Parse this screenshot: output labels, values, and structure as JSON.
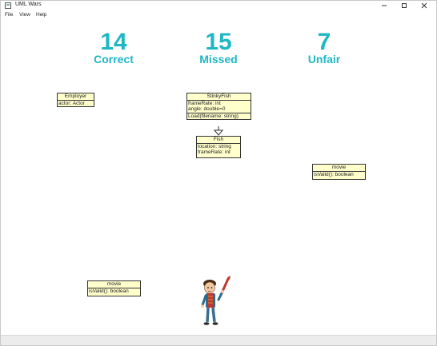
{
  "window": {
    "title": "UML Wars"
  },
  "menu": {
    "items": [
      "File",
      "View",
      "Help"
    ]
  },
  "scores": {
    "correct": {
      "value": "14",
      "label": "Correct"
    },
    "missed": {
      "value": "15",
      "label": "Missed"
    },
    "unfair": {
      "value": "7",
      "label": "Unfair"
    }
  },
  "colors": {
    "score": "#1fb7c4",
    "uml_fill": "#ffffcc"
  },
  "uml": {
    "employer": {
      "name": "Employer",
      "attributes": [
        "actor: Actor"
      ]
    },
    "stinkyfish": {
      "name": "StinkyFish",
      "attributes": [
        "frameRate: int",
        "angle: double=0"
      ],
      "operations": [
        "Load(filename: string)"
      ]
    },
    "fish": {
      "name": "Fish",
      "attributes": [
        "location: string",
        "frameRate: int"
      ]
    },
    "movie_right": {
      "name": "movie",
      "operations": [
        "isValid(): boolean"
      ]
    },
    "movie_left": {
      "name": "movie",
      "operations": [
        "isValid(): boolean"
      ]
    }
  },
  "icons": {
    "app": "app-icon",
    "minimize": "minimize-icon",
    "maximize": "maximize-icon",
    "close": "close-icon",
    "inheritance_arrow": "inheritance-arrow-icon",
    "player": "player-character-icon"
  }
}
